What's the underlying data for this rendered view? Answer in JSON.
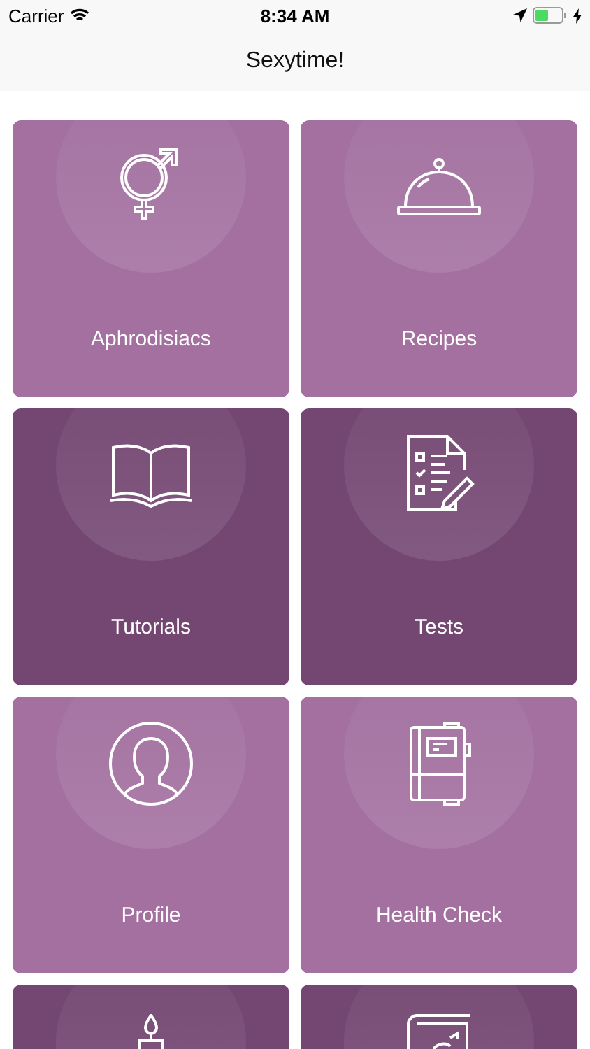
{
  "status_bar": {
    "carrier": "Carrier",
    "time": "8:34 AM"
  },
  "nav_bar": {
    "title": "Sexytime!"
  },
  "tiles": [
    {
      "label": "Aphrodisiacs",
      "color": "#a370a0"
    },
    {
      "label": "Recipes",
      "color": "#a370a0"
    },
    {
      "label": "Tutorials",
      "color": "#744772"
    },
    {
      "label": "Tests",
      "color": "#744772"
    },
    {
      "label": "Profile",
      "color": "#a370a0"
    },
    {
      "label": "Health Check",
      "color": "#a370a0"
    },
    {
      "color": "#744772"
    },
    {
      "color": "#744772"
    }
  ]
}
